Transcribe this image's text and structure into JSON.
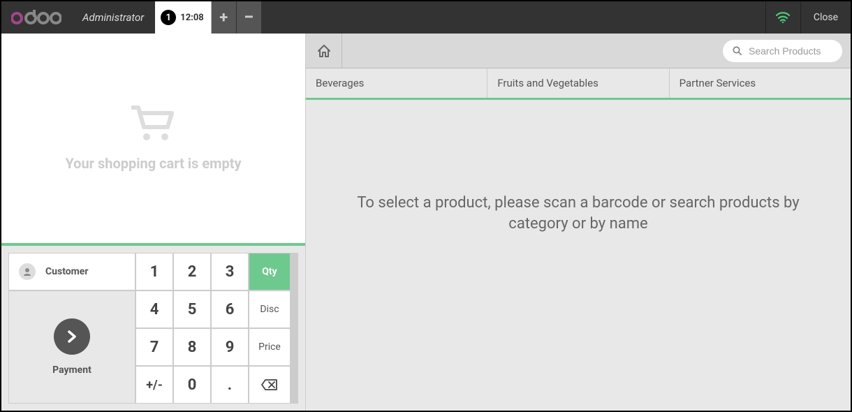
{
  "topbar": {
    "user": "Administrator",
    "order_number": "1",
    "order_time": "12:08",
    "close_label": "Close"
  },
  "cart": {
    "empty_message": "Your shopping cart is empty"
  },
  "actionpad": {
    "customer_label": "Customer",
    "payment_label": "Payment"
  },
  "numpad": {
    "k1": "1",
    "k2": "2",
    "k3": "3",
    "k4": "4",
    "k5": "5",
    "k6": "6",
    "k7": "7",
    "k8": "8",
    "k9": "9",
    "sign": "+/-",
    "k0": "0",
    "dot": ".",
    "mode_qty": "Qty",
    "mode_disc": "Disc",
    "mode_price": "Price"
  },
  "search": {
    "placeholder": "Search Products"
  },
  "categories": [
    "Beverages",
    "Fruits and Vegetables",
    "Partner Services"
  ],
  "product_hint": "To select a product, please scan a barcode or search products by category or by name"
}
